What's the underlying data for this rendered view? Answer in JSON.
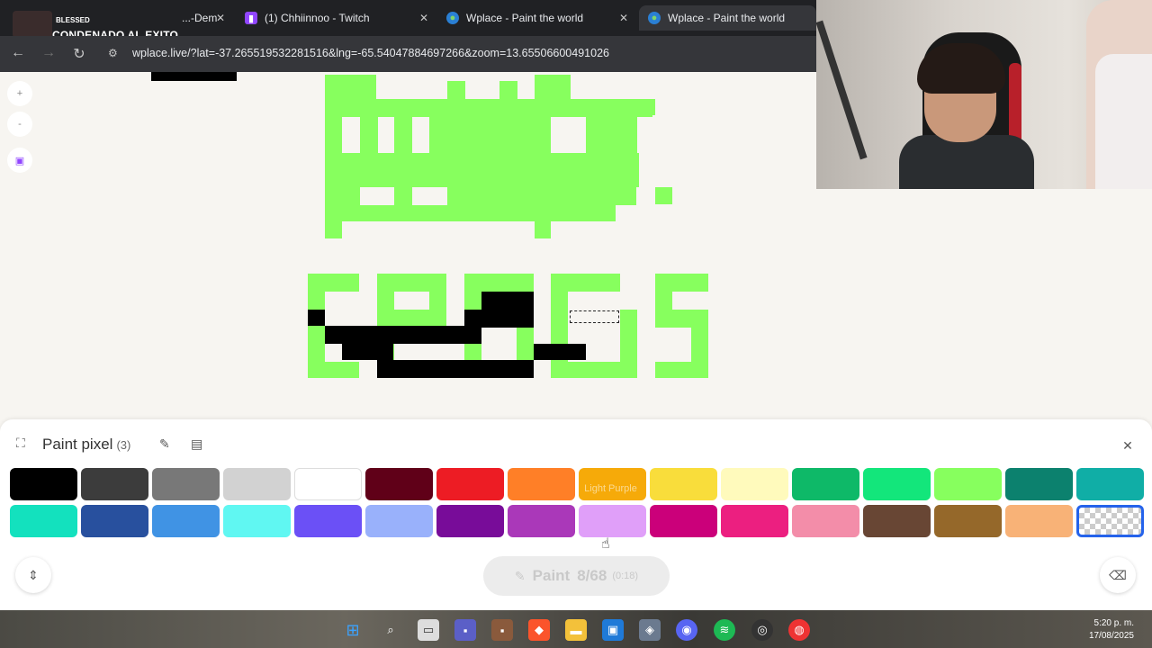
{
  "browser": {
    "overlay": {
      "logo_text": "",
      "blessed": "BLESSED",
      "title": "CONDENADO AL EXITO"
    },
    "tabs": [
      {
        "label": "...-Dem",
        "active": false
      },
      {
        "label": "(1) Chhiinnoo - Twitch",
        "active": false
      },
      {
        "label": "Wplace - Paint the world",
        "active": false
      },
      {
        "label": "Wplace - Paint the world",
        "active": true
      }
    ],
    "url": "wplace.live/?lat=-37.265519532281516&lng=-65.54047884697266&zoom=13.65506600491026"
  },
  "side_controls": {
    "zoom_in": "+",
    "zoom_out": "-"
  },
  "panel": {
    "title": "Paint pixel",
    "count": "(3)",
    "tooltip": "Light Purple",
    "paint_button": {
      "label": "Paint",
      "progress": "8/68",
      "timer": "(0:18)"
    },
    "palette_row1": [
      "#000000",
      "#3c3c3c",
      "#787878",
      "#d2d2d2",
      "#ffffff",
      "#600018",
      "#ed1c24",
      "#ff7f27",
      "#f6aa09",
      "#f9dd3b",
      "#fffabc",
      "#0eb968",
      "#13e67b",
      "#87ff5e",
      "#0c816e",
      "#10aea6"
    ],
    "palette_row2": [
      "#13e1be",
      "#28509e",
      "#4093e4",
      "#60f7f2",
      "#6b50f6",
      "#99b1fb",
      "#780c99",
      "#aa38b9",
      "#e09ff9",
      "#cb007a",
      "#ec1f80",
      "#f38da9",
      "#684634",
      "#95682a",
      "#f8b277",
      "transparent"
    ]
  },
  "taskbar": {
    "time": "5:20 p. m.",
    "date": "17/08/2025"
  },
  "colors": {
    "pixel_green": "#87ff5e",
    "pixel_black": "#000000",
    "selected_border": "#2563eb"
  }
}
